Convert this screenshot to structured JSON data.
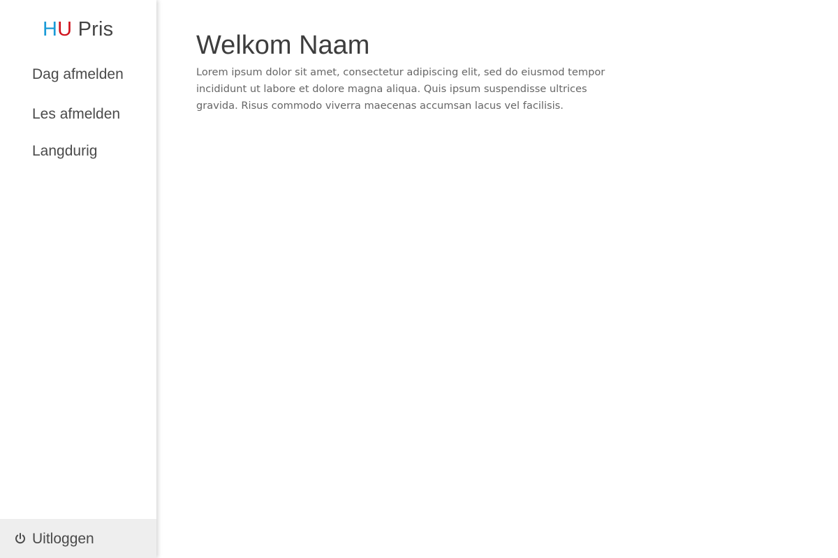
{
  "sidebar": {
    "logo": {
      "letter_h": "H",
      "letter_u": "U",
      "rest": " Pris",
      "color_h": "#1a9bd7",
      "color_u": "#d0131d"
    },
    "items": [
      {
        "label": "Dag afmelden"
      },
      {
        "label": "Les afmelden"
      },
      {
        "label": "Langdurig"
      }
    ],
    "logout": {
      "icon": "power-icon",
      "label": "Uitloggen"
    }
  },
  "main": {
    "title": "Welkom Naam",
    "intro": "Lorem ipsum dolor sit amet, consectetur adipiscing elit, sed do eiusmod tempor incididunt ut labore et dolore magna aliqua. Quis ipsum suspendisse ultrices gravida. Risus commodo viverra maecenas accumsan lacus vel facilisis."
  }
}
